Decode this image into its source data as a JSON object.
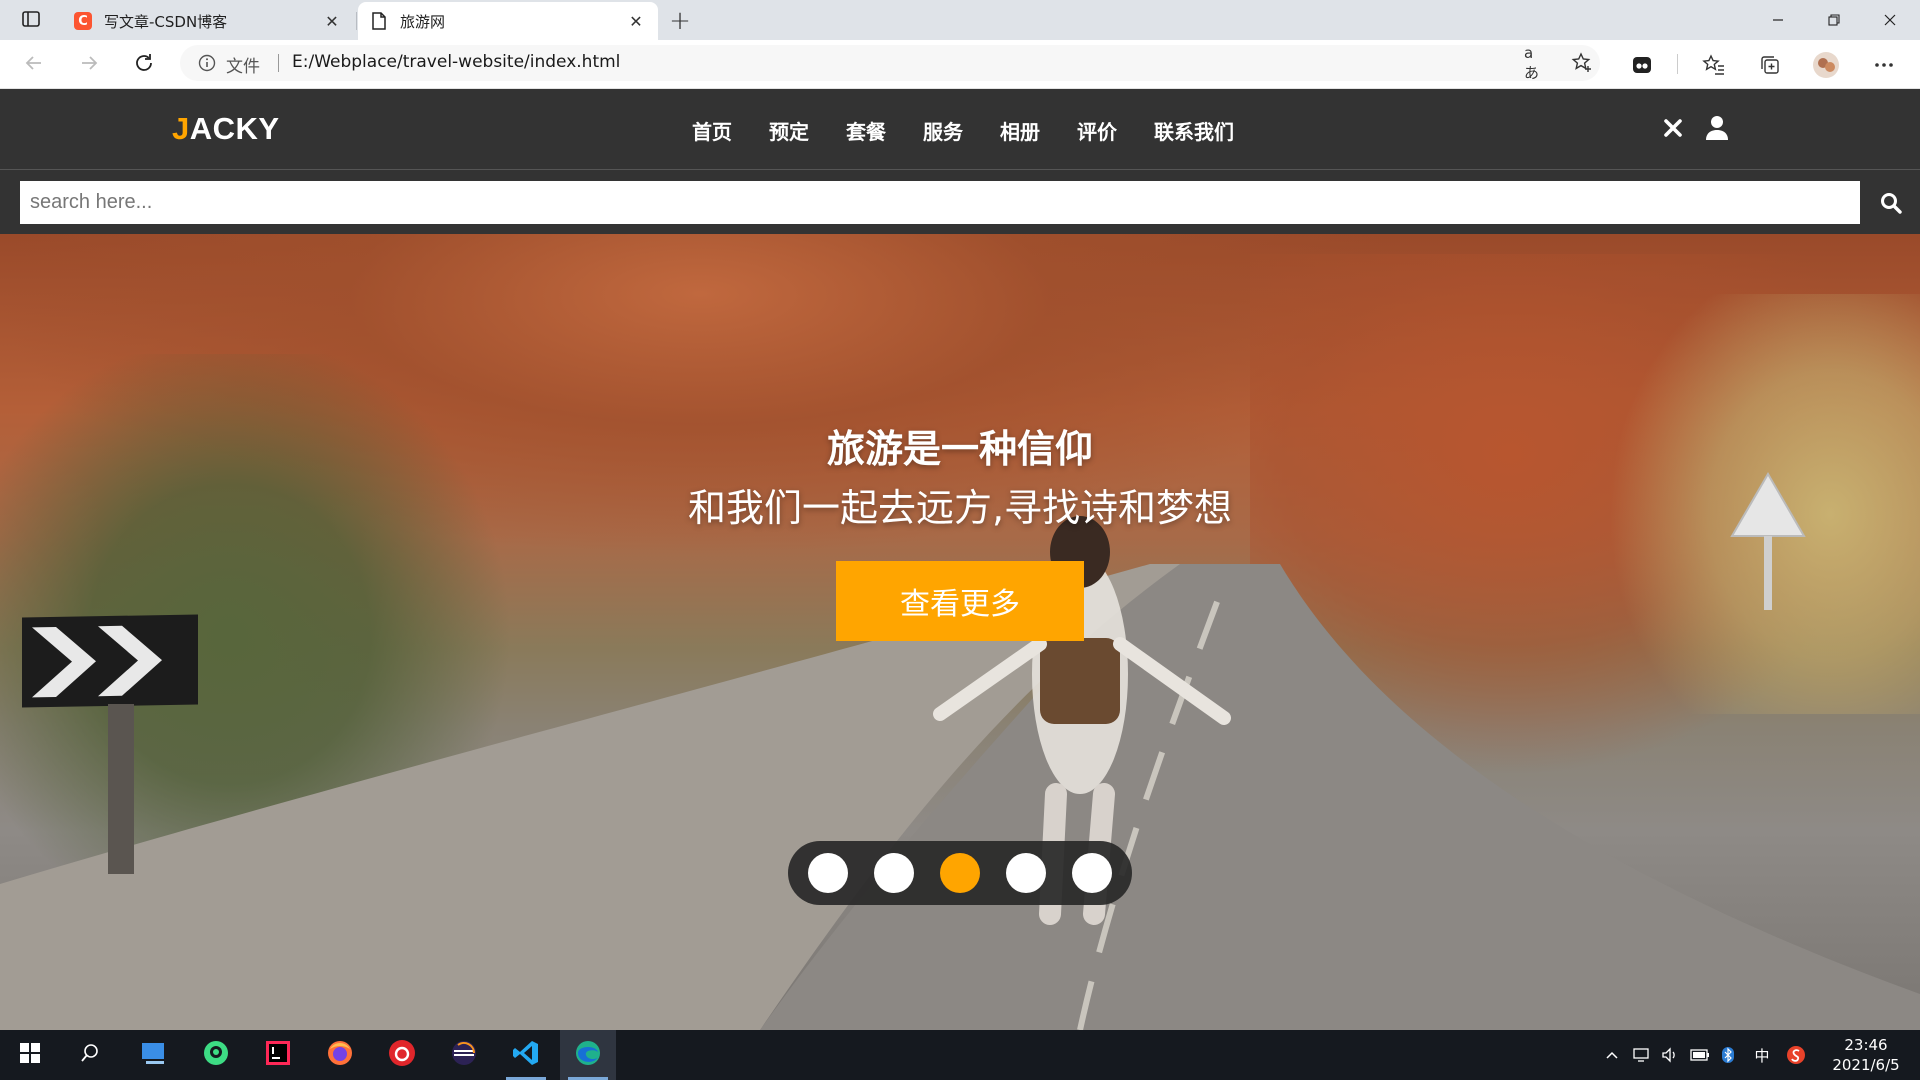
{
  "browser": {
    "tabs": [
      {
        "title": "写文章-CSDN博客",
        "favicon": "C",
        "active": false
      },
      {
        "title": "旅游网",
        "active": true
      }
    ],
    "address": {
      "scheme_label": "文件",
      "url": "E:/Webplace/travel-website/index.html"
    },
    "icons": [
      "tab-actions-icon",
      "close-icon",
      "new-tab-icon",
      "minimize-icon",
      "restore-icon",
      "window-close-icon",
      "back-icon",
      "forward-icon",
      "refresh-icon",
      "info-icon",
      "read-aloud-icon",
      "add-favorite-icon",
      "extension-icon",
      "favorites-icon",
      "collections-icon",
      "profile-avatar-icon",
      "more-icon"
    ],
    "read_aloud_label": "aあ"
  },
  "site": {
    "logo_first": "J",
    "logo_rest": "ACKY",
    "logo_accent_color": "#ffa500",
    "nav": [
      "首页",
      "预定",
      "套餐",
      "服务",
      "相册",
      "评价",
      "联系我们"
    ],
    "search_placeholder": "search here...",
    "header_icons": [
      "close-icon",
      "user-icon",
      "search-icon"
    ]
  },
  "hero": {
    "title": "旅游是一种信仰",
    "subtitle": "和我们一起去远方,寻找诗和梦想",
    "button_label": "查看更多",
    "button_color": "#ffa500",
    "slides": 5,
    "active_slide": 3
  },
  "taskbar": {
    "apps": [
      "windows-start-icon",
      "search-icon",
      "desktop-app-icon",
      "android-studio-icon",
      "intellij-icon",
      "firefox-icon",
      "netease-music-icon",
      "eclipse-icon",
      "vscode-icon",
      "edge-icon"
    ],
    "ime_label": "中",
    "time": "23:46",
    "date": "2021/6/5"
  }
}
